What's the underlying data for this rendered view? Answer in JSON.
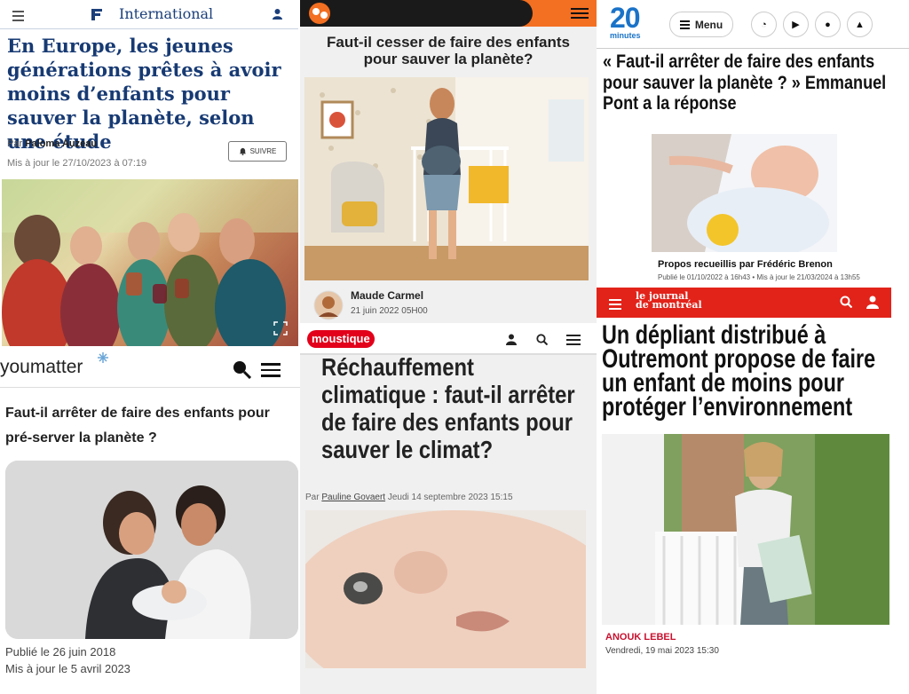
{
  "panels": {
    "france24": {
      "section": "International",
      "title": "En Europe, les jeunes générations prêtes à avoir moins d’enfants pour sauver la planète, selon une étude",
      "by_prefix": "Par",
      "author": "Paloma Auzeau",
      "updated": "Mis à jour le 27/10/2023 à 07:19",
      "follow_label": "SUIVRE",
      "colors": {
        "brand": "#1b3f7a"
      }
    },
    "panel2": {
      "title": "Faut-il cesser de faire des enfants pour sauver la planète?",
      "author": "Maude Carmel",
      "date": "21 juin 2022 05H00",
      "colors": {
        "accent": "#f36f21"
      }
    },
    "twenty_minutes": {
      "logo_top": "20",
      "logo_bottom": "minutes",
      "menu_label": "Menu",
      "title": "« Faut-il arrêter de faire des enfants pour sauver la planète ? » Emmanuel Pont a la réponse",
      "credit": "Propos recueillis par Frédéric Brenon",
      "published": "Publié le 01/10/2022 à 16h43 • Mis à jour le 21/03/2024 à 13h55",
      "colors": {
        "logo": "#1a73c8"
      }
    },
    "youmatter": {
      "logo": "youmatter",
      "title": "Faut-il arrêter de faire des enfants pour pré-server la planète ?",
      "published": "Publié le 26 juin 2018",
      "updated": "Mis à jour le 5 avril 2023"
    },
    "moustique": {
      "logo": "moustique",
      "title": "Réchauffement climatique : faut-il arrêter de faire des enfants pour sauver le climat?",
      "by_prefix": "Par",
      "author": "Pauline Govaert",
      "date": "Jeudi 14 septembre 2023 15:15",
      "colors": {
        "logo": "#e2001a"
      }
    },
    "journal": {
      "logo_line1": "le journal",
      "logo_line2": "de montréal",
      "title": "Un dépliant distribué à Outremont propose de faire un enfant de moins pour protéger l’environnement",
      "author": "ANOUK LEBEL",
      "date": "Vendredi, 19 mai 2023 15:30",
      "colors": {
        "header": "#e2231a",
        "author": "#c8102e"
      }
    }
  }
}
